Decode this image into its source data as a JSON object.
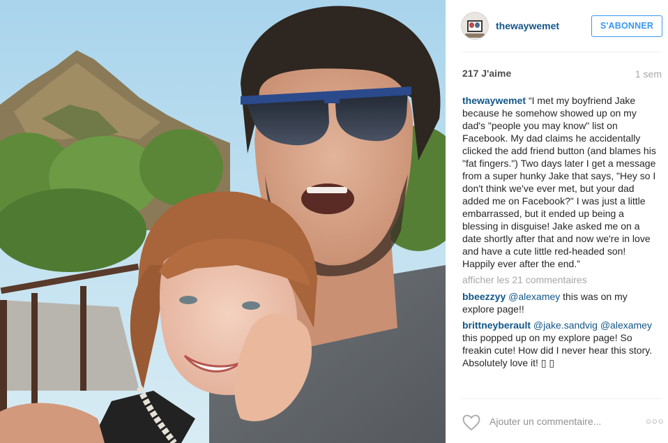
{
  "post": {
    "username": "thewaywemet",
    "follow_label": "S'ABONNER",
    "likes": "217 J'aime",
    "time": "1 sem",
    "caption_user": "thewaywemet",
    "caption_text": "“I met my boyfriend Jake because he somehow showed up on my dad's \"people you may know\" list on Facebook. My dad claims he accidentally clicked the add friend button (and blames his \"fat fingers.\") Two days later I get a message from a super hunky Jake that says, \"Hey so I don't think we've ever met, but your dad added me on Facebook?\" I was just a little embarrassed, but it ended up being a blessing in disguise! Jake asked me on a date shortly after that and now we're in love and have a cute little red-headed son! Happily ever after the end.”",
    "view_more": "afficher les 21 commentaires",
    "comments": [
      {
        "user": "bbeezzyy",
        "mention": "@alexamey",
        "text": " this was on my explore page!!"
      },
      {
        "user": "brittneyberault",
        "mention": "@jake.sandvig",
        "mention2": "@alexamey",
        "text": " this popped up on my explore page! So freakin cute! How did I never hear this story. Absolutely love it! ▯ ▯"
      }
    ],
    "add_comment_placeholder": "Ajouter un commentaire...",
    "more_options": "○○○"
  },
  "icons": {
    "heart": "heart-icon",
    "more": "more-options-icon",
    "avatar": "avatar"
  },
  "colors": {
    "link_blue": "#125688",
    "button_blue": "#3897f0",
    "muted": "#a5a7aa"
  }
}
